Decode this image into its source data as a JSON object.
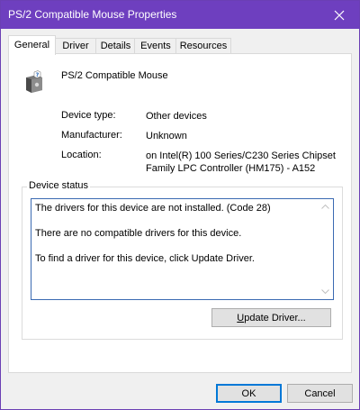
{
  "window": {
    "title": "PS/2 Compatible Mouse Properties"
  },
  "tabs": [
    {
      "label": "General",
      "active": true
    },
    {
      "label": "Driver"
    },
    {
      "label": "Details"
    },
    {
      "label": "Events"
    },
    {
      "label": "Resources"
    }
  ],
  "device": {
    "name": "PS/2 Compatible Mouse",
    "icon": "mouse-device-icon",
    "properties": [
      {
        "label": "Device type:",
        "value": "Other devices"
      },
      {
        "label": "Manufacturer:",
        "value": "Unknown"
      },
      {
        "label": "Location:",
        "value_line1": "on Intel(R) 100 Series/C230 Series Chipset",
        "value_line2": "Family LPC Controller (HM175) - A152"
      }
    ]
  },
  "status": {
    "group_label": "Device status",
    "lines": [
      "The drivers for this device are not installed. (Code 28)",
      "There are no compatible drivers for this device.",
      "To find a driver for this device, click Update Driver."
    ]
  },
  "buttons": {
    "update_driver_first": "U",
    "update_driver_rest": "pdate Driver...",
    "ok": "OK",
    "cancel": "Cancel"
  },
  "colors": {
    "titlebar": "#6e3fbf",
    "focus_border": "#3b6ab2"
  }
}
